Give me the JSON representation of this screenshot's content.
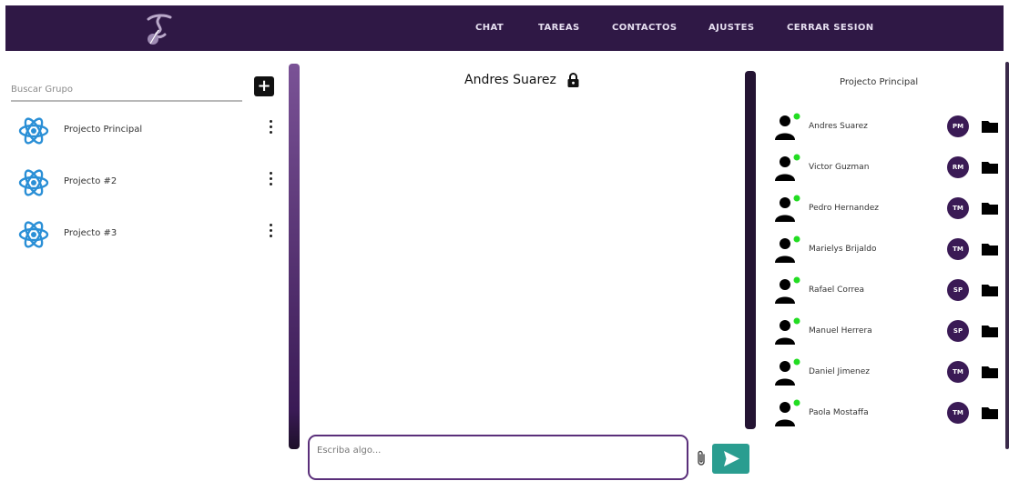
{
  "nav": {
    "items": [
      {
        "label": "CHAT"
      },
      {
        "label": "TAREAS"
      },
      {
        "label": "CONTACTOS"
      },
      {
        "label": "AJUSTES"
      },
      {
        "label": "CERRAR SESION"
      }
    ]
  },
  "sidebar": {
    "search_placeholder": "Buscar Grupo",
    "add_label": "+",
    "groups": [
      {
        "label": "Projecto Principal",
        "icon": "react-atom-icon"
      },
      {
        "label": "Projecto #2",
        "icon": "react-atom-icon"
      },
      {
        "label": "Projecto #3",
        "icon": "react-atom-icon"
      }
    ]
  },
  "chat": {
    "title": "Andres Suarez",
    "title_icon": "lock-icon",
    "input_placeholder": "Escriba algo...",
    "attach_icon": "paperclip-icon",
    "send_icon": "send-icon"
  },
  "members_panel": {
    "title": "Projecto Principal",
    "members": [
      {
        "name": "Andres Suarez",
        "badge": "PM",
        "status": "online"
      },
      {
        "name": "Victor Guzman",
        "badge": "RM",
        "status": "online"
      },
      {
        "name": "Pedro Hernandez",
        "badge": "TM",
        "status": "online"
      },
      {
        "name": "Marielys Brijaldo",
        "badge": "TM",
        "status": "online"
      },
      {
        "name": "Rafael Correa",
        "badge": "SP",
        "status": "online"
      },
      {
        "name": "Manuel Herrera",
        "badge": "SP",
        "status": "online"
      },
      {
        "name": "Daniel Jimenez",
        "badge": "TM",
        "status": "online"
      },
      {
        "name": "Paola Mostaffa",
        "badge": "TM",
        "status": "online"
      }
    ]
  },
  "colors": {
    "topbar": "#2f1845",
    "accent_purple": "#5a2f7a",
    "send_button": "#2a9d90",
    "online_dot": "#22dd22",
    "react_icon": "#2a8fd6"
  }
}
